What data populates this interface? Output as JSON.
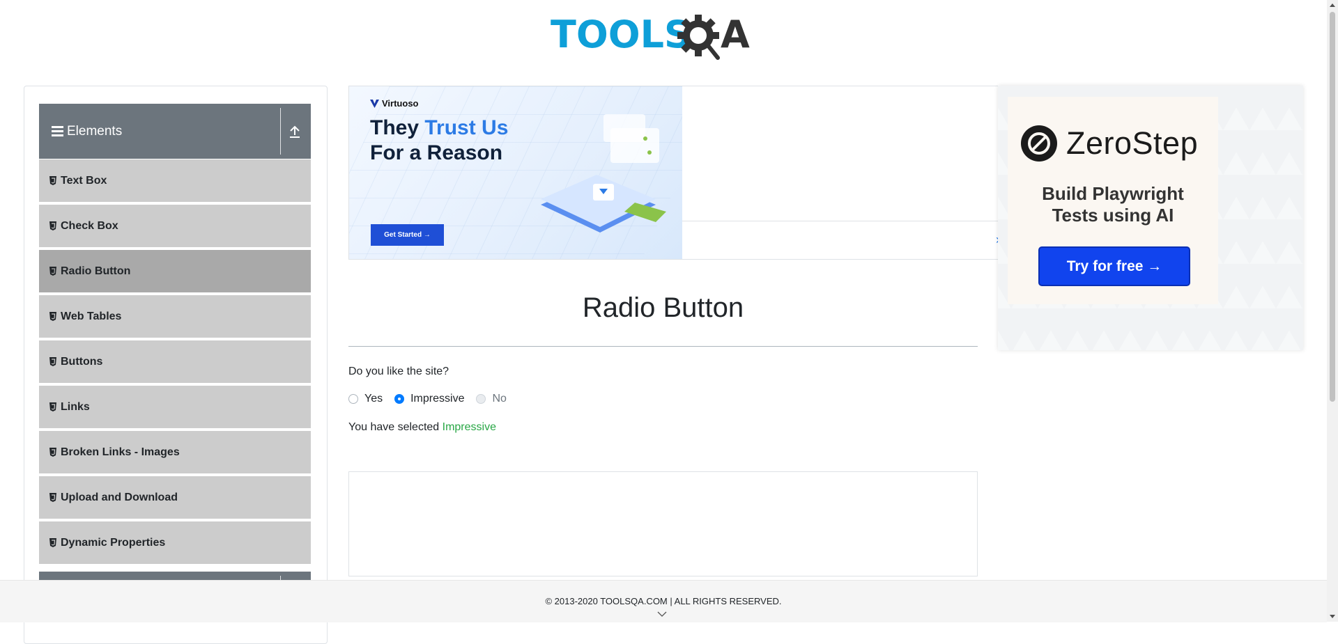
{
  "header": {
    "logo_text_1": "TOOLS",
    "logo_text_2": "A"
  },
  "sidebar": {
    "group_title": "Elements",
    "items": [
      {
        "label": "Text Box"
      },
      {
        "label": "Check Box"
      },
      {
        "label": "Radio Button",
        "active": true
      },
      {
        "label": "Web Tables"
      },
      {
        "label": "Buttons"
      },
      {
        "label": "Links"
      },
      {
        "label": "Broken Links - Images"
      },
      {
        "label": "Upload and Download"
      },
      {
        "label": "Dynamic Properties"
      }
    ]
  },
  "ad_banner": {
    "brand": "Virtuoso",
    "headline_1": "They ",
    "headline_accent": "Trust Us",
    "headline_2": "For a Reason",
    "cta": "Get Started →"
  },
  "right_ad": {
    "brand": "ZeroStep",
    "subline_1": "Build Playwright",
    "subline_2": "Tests using AI",
    "cta": "Try for free →"
  },
  "main": {
    "title": "Radio Button",
    "question": "Do you like the site?",
    "options": [
      {
        "label": "Yes",
        "checked": false,
        "disabled": false
      },
      {
        "label": "Impressive",
        "checked": true,
        "disabled": false
      },
      {
        "label": "No",
        "checked": false,
        "disabled": true
      }
    ],
    "result_prefix": "You have selected ",
    "result_value": "Impressive"
  },
  "footer": {
    "text": "© 2013-2020 TOOLSQA.COM | ALL RIGHTS RESERVED."
  },
  "colors": {
    "accent": "#007bff",
    "success": "#28a745",
    "sidebar_header": "#6c757d",
    "menu_item": "#cccccc",
    "menu_active": "#a9a9a9",
    "logo_blue": "#0e9fd8"
  }
}
